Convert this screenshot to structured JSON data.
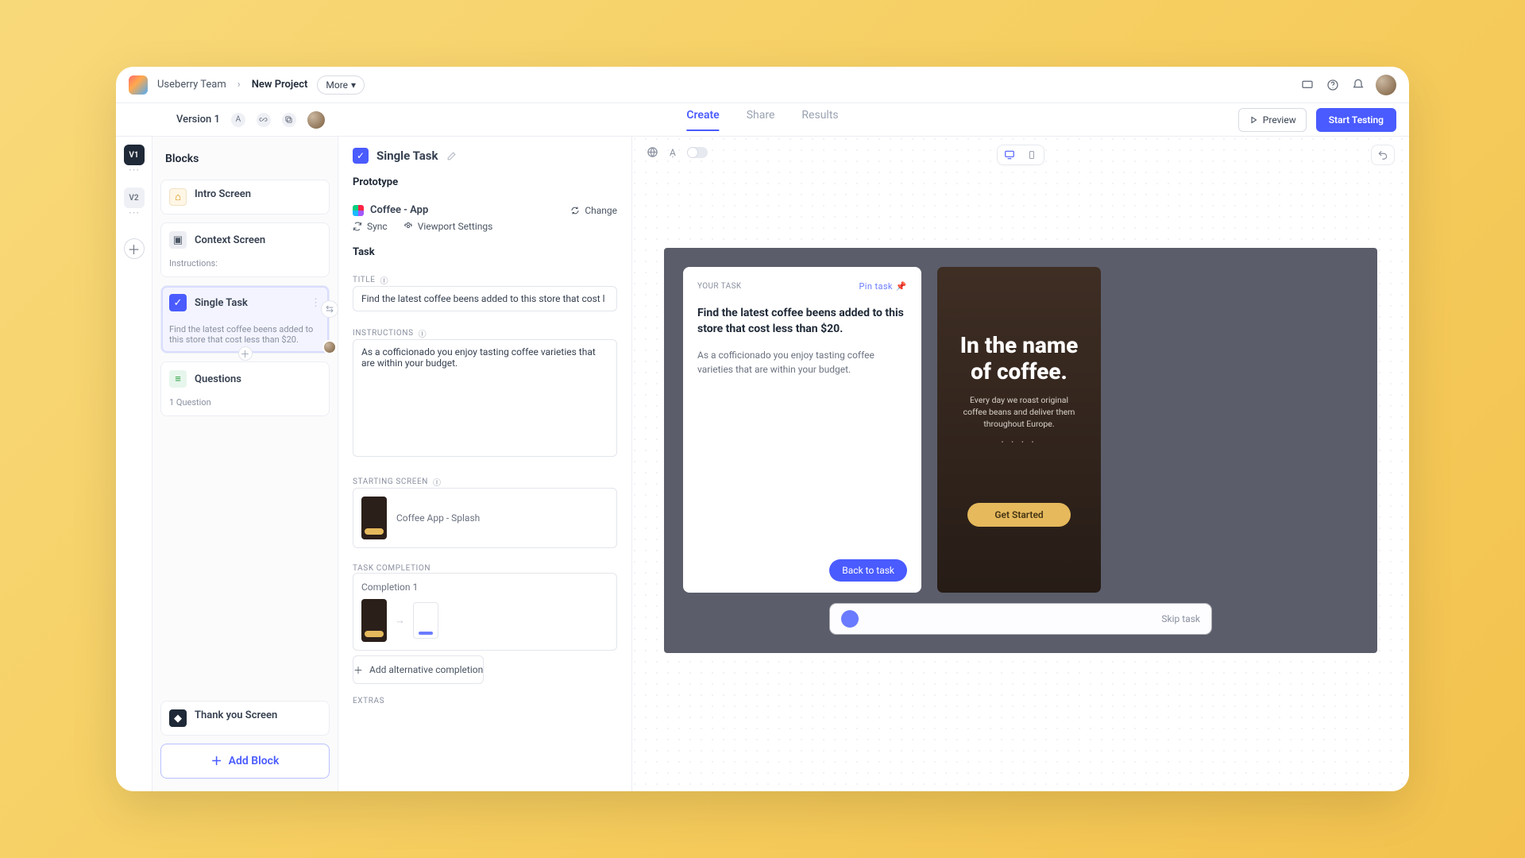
{
  "top": {
    "team": "Useberry Team",
    "project": "New Project",
    "more": "More"
  },
  "second": {
    "version": "Version 1",
    "tabs": {
      "create": "Create",
      "share": "Share",
      "results": "Results"
    },
    "preview": "Preview",
    "start": "Start Testing"
  },
  "rail": {
    "v1": "V1",
    "v2": "V2"
  },
  "sidebar": {
    "heading": "Blocks",
    "intro": "Intro Screen",
    "context": "Context Screen",
    "context_sub": "Instructions:",
    "task": "Single Task",
    "task_sub": "Find the latest coffee beens added to this store that cost less than $20.",
    "questions": "Questions",
    "questions_sub": "1 Question",
    "thank": "Thank you Screen",
    "add_block": "Add Block"
  },
  "detail": {
    "title": "Single Task",
    "section_proto": "Prototype",
    "proto_name": "Coffee - App",
    "change": "Change",
    "sync": "Sync",
    "viewport": "Viewport Settings",
    "section_task": "Task",
    "label_title": "TITLE",
    "title_value": "Find the latest coffee beens added to this store that cost l",
    "label_instr": "INSTRUCTIONS",
    "instr_value": "As a cofficionado you enjoy tasting coffee varieties that are within your budget.",
    "label_start": "STARTING SCREEN",
    "start_name": "Coffee App - Splash",
    "label_comp": "TASK COMPLETION",
    "comp_name": "Completion 1",
    "alt": "Add alternative completion",
    "extras": "EXTRAS"
  },
  "preview": {
    "label": "YOUR TASK",
    "pin": "Pin task",
    "task_title": "Find the latest coffee beens added to this store that cost less than $20.",
    "task_desc": "As a cofficionado you enjoy tasting coffee varieties that are within your budget.",
    "back": "Back to task",
    "phone_heading": "In the name of coffee.",
    "phone_sub": "Every day we roast original coffee beans and deliver them throughout Europe.",
    "cta": "Get Started",
    "skip": "Skip task"
  }
}
